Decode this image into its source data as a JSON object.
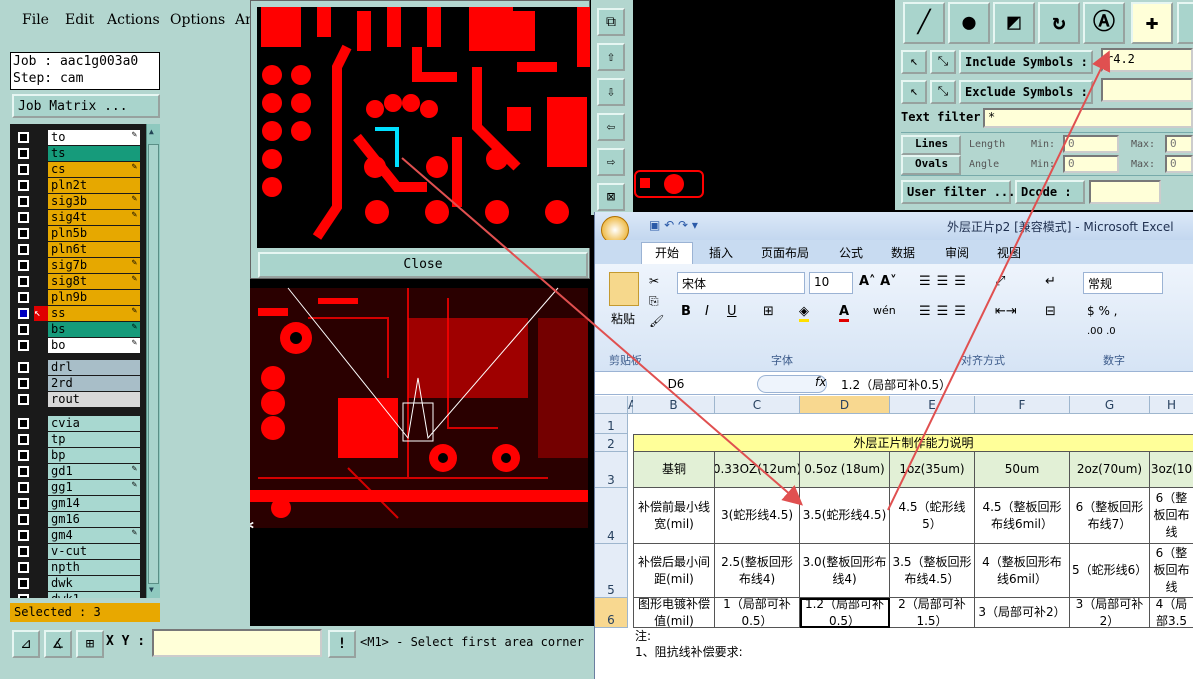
{
  "menu": {
    "items": [
      "File",
      "Edit",
      "Actions",
      "Options",
      "An"
    ]
  },
  "job": {
    "job_line": "Job : aac1g003a0",
    "step_line": "Step: cam",
    "matrix_button": "Job Matrix ..."
  },
  "layers": [
    {
      "name": "to",
      "color": "#ffffff",
      "editable": true
    },
    {
      "name": "ts",
      "color": "#169b7b",
      "editable": false
    },
    {
      "name": "cs",
      "color": "#e6a800",
      "editable": true
    },
    {
      "name": "pln2t",
      "color": "#e6a800",
      "editable": false
    },
    {
      "name": "sig3b",
      "color": "#e6a800",
      "editable": true
    },
    {
      "name": "sig4t",
      "color": "#e6a800",
      "editable": true
    },
    {
      "name": "pln5b",
      "color": "#e6a800",
      "editable": false
    },
    {
      "name": "pln6t",
      "color": "#e6a800",
      "editable": false
    },
    {
      "name": "sig7b",
      "color": "#e6a800",
      "editable": true
    },
    {
      "name": "sig8t",
      "color": "#e6a800",
      "editable": true
    },
    {
      "name": "pln9b",
      "color": "#e6a800",
      "editable": false
    },
    {
      "name": "ss",
      "color": "#e6a800",
      "editable": true,
      "active": true
    },
    {
      "name": "bs",
      "color": "#169b7b",
      "editable": true
    },
    {
      "name": "bo",
      "color": "#ffffff",
      "editable": true
    },
    {
      "name": "drl",
      "color": "#a8bec8",
      "editable": false
    },
    {
      "name": "2rd",
      "color": "#a8bec8",
      "editable": false
    },
    {
      "name": "rout",
      "color": "#d8d8d8",
      "editable": false
    },
    {
      "name": "cvia",
      "color": "#a8d8d0",
      "editable": false
    },
    {
      "name": "tp",
      "color": "#a8d8d0",
      "editable": false
    },
    {
      "name": "bp",
      "color": "#a8d8d0",
      "editable": false
    },
    {
      "name": "gd1",
      "color": "#a8d8d0",
      "editable": true
    },
    {
      "name": "gg1",
      "color": "#a8d8d0",
      "editable": true
    },
    {
      "name": "gm14",
      "color": "#a8d8d0",
      "editable": false
    },
    {
      "name": "gm16",
      "color": "#a8d8d0",
      "editable": false
    },
    {
      "name": "gm4",
      "color": "#a8d8d0",
      "editable": true
    },
    {
      "name": "v-cut",
      "color": "#a8d8d0",
      "editable": false
    },
    {
      "name": "npth",
      "color": "#a8d8d0",
      "editable": false
    },
    {
      "name": "dwk",
      "color": "#a8d8d0",
      "editable": false
    },
    {
      "name": "dwk1",
      "color": "#a8d8d0",
      "editable": false
    }
  ],
  "status": {
    "selected": "Selected : 3",
    "xy_label": "X Y :",
    "message": "<M1> - Select first area corner"
  },
  "graphic": {
    "close_label": "Close"
  },
  "filters": {
    "include_label": "Include Symbols :",
    "include_value": "r4.2",
    "exclude_label": "Exclude Symbols :",
    "exclude_value": "",
    "text_filter_label": "Text filter",
    "text_filter_value": "*",
    "lines_label": "Lines",
    "ovals_label": "Ovals",
    "length_label": "Length",
    "angle_label": "Angle",
    "min_label": "Min:",
    "max_label": "Max:",
    "min_value": "0",
    "max_value": "0",
    "user_filter_label": "User filter ...",
    "dcode_label": "Dcode :"
  },
  "excel": {
    "title": "外层正片p2  [兼容模式] - Microsoft Excel",
    "tabs": [
      "开始",
      "插入",
      "页面布局",
      "公式",
      "数据",
      "审阅",
      "视图"
    ],
    "groups": {
      "clipboard": "剪贴板",
      "font": "字体",
      "align": "对齐方式",
      "number": "数字"
    },
    "paste": "粘贴",
    "font_name": "宋体",
    "font_size": "10",
    "number_format": "常规",
    "name_box": "D6",
    "formula": "1.2（局部可补0.5）",
    "fx": "fx",
    "col_headers": [
      "A",
      "B",
      "C",
      "D",
      "E",
      "F",
      "G",
      "H"
    ],
    "row_headers": [
      "1",
      "2",
      "3",
      "4",
      "5",
      "6"
    ],
    "table_title": "外层正片制作能力说明",
    "header_row": [
      "基铜",
      "0.33OZ(12um)",
      "0.5oz\n(18um)",
      "1oz(35um)",
      "50um",
      "2oz(70um)",
      "3oz(10"
    ],
    "rows": [
      [
        "补偿前最小线宽(mil)",
        "3(蛇形线4.5)",
        "3.5(蛇形线4.5)",
        "4.5（蛇形线5）",
        "4.5（整板回形布线6mil）",
        "6（整板回形布线7）",
        "6（整板回布线"
      ],
      [
        "补偿后最小间距(mil)",
        "2.5(整板回形布线4)",
        "3.0(整板回形布线4)",
        "3.5（整板回形布线4.5）",
        "4（整板回形布线6mil）",
        "5（蛇形线6）",
        "6（整板回布线"
      ],
      [
        "图形电镀补偿值(mil)",
        "1（局部可补0.5）",
        "1.2（局部可补0.5）",
        "2（局部可补1.5）",
        "3（局部可补2）",
        "3（局部可补2）",
        "4（局部3.5"
      ]
    ],
    "note1": "注:",
    "note2": "1、阻抗线补偿要求:"
  },
  "colors": {
    "pcb_red": "#ff0000",
    "panel_teal": "#b3d6cf",
    "arrow_red": "#e05050"
  }
}
